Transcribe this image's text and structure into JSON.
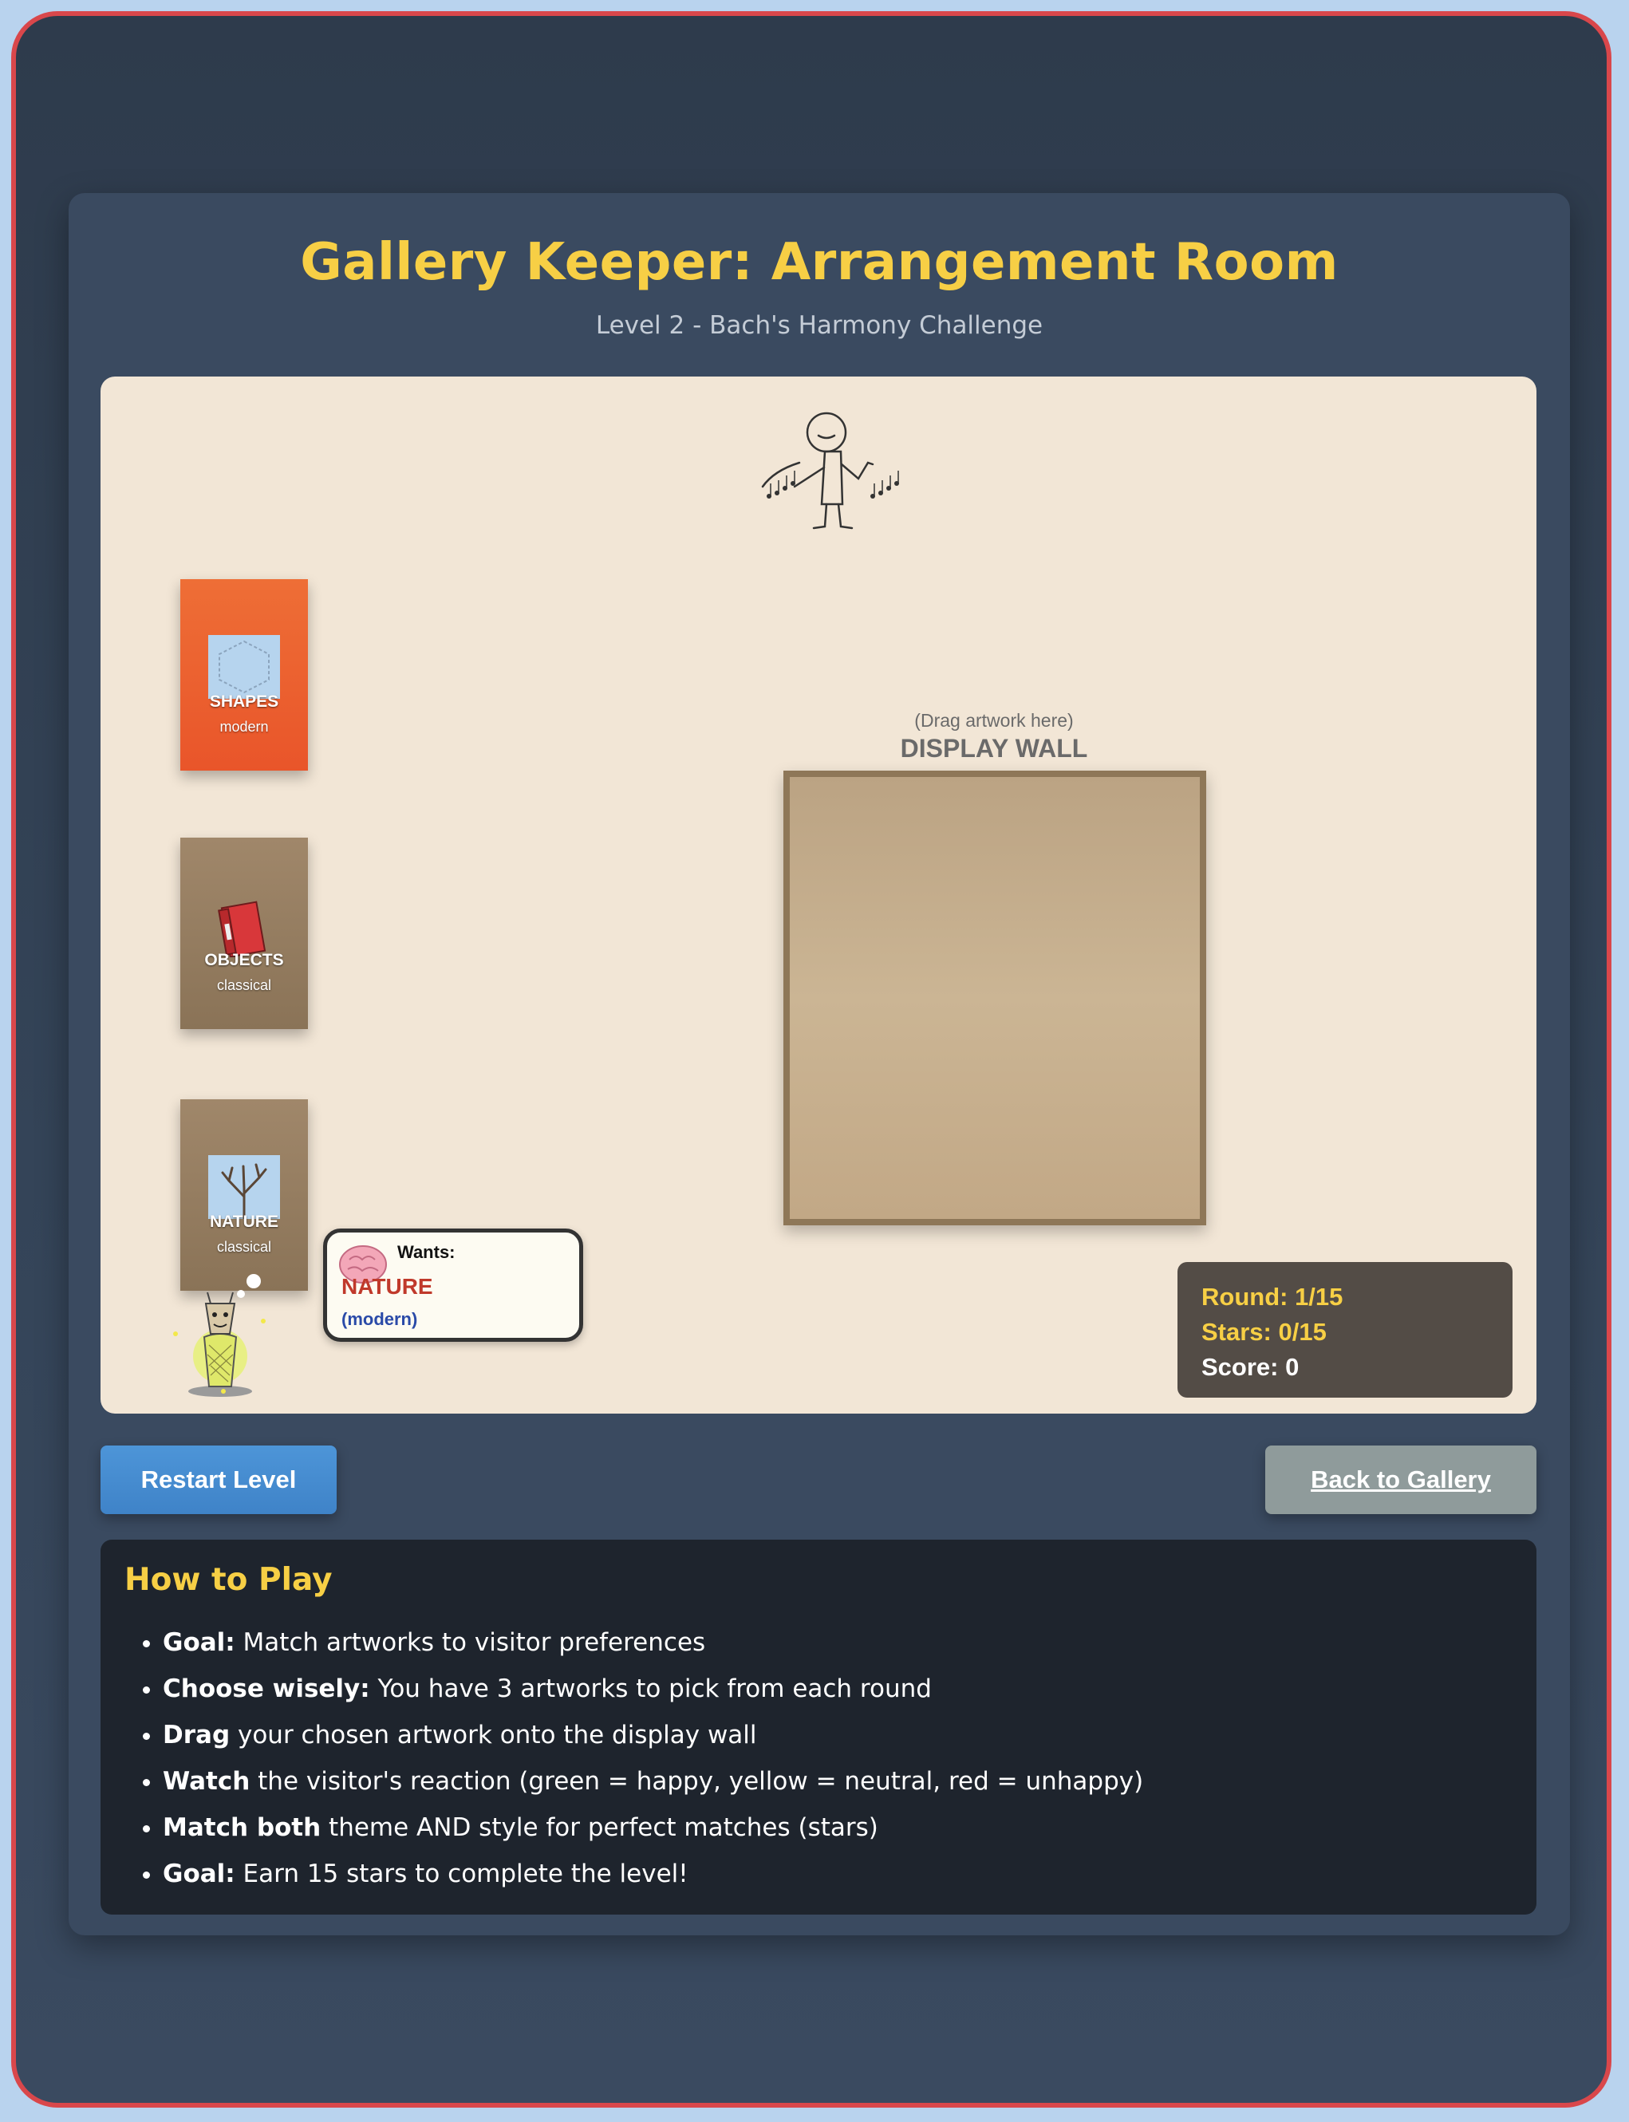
{
  "header": {
    "title": "Gallery Keeper: Arrangement Room",
    "subtitle": "Level 2 - Bach's Harmony Challenge"
  },
  "artworks": [
    {
      "theme": "SHAPES",
      "style": "modern",
      "color": "#e9552a",
      "icon": "hexagon-shape-icon"
    },
    {
      "theme": "OBJECTS",
      "style": "classical",
      "color": "#8a7357",
      "icon": "red-binder-icon"
    },
    {
      "theme": "NATURE",
      "style": "classical",
      "color": "#8a7357",
      "icon": "bare-tree-icon"
    }
  ],
  "display_wall": {
    "hint": "(Drag artwork here)",
    "label": "DISPLAY WALL"
  },
  "visitor": {
    "wants_label": "Wants:",
    "theme": "NATURE",
    "style": "(modern)"
  },
  "stats": {
    "round": "Round: 1/15",
    "stars": "Stars: 0/15",
    "score": "Score: 0"
  },
  "buttons": {
    "restart": "Restart Level",
    "back": "Back to Gallery"
  },
  "how_to_play": {
    "title": "How to Play",
    "items": [
      {
        "bold": "Goal:",
        "text": " Match artworks to visitor preferences"
      },
      {
        "bold": "Choose wisely:",
        "text": " You have 3 artworks to pick from each round"
      },
      {
        "bold": "Drag",
        "text": " your chosen artwork onto the display wall"
      },
      {
        "bold": "Watch",
        "text": " the visitor's reaction (green = happy, yellow = neutral, red = unhappy)"
      },
      {
        "bold": "Match both",
        "text": " theme AND style for perfect matches (stars)"
      },
      {
        "bold": "Goal:",
        "text": " Earn 15 stars to complete the level!"
      }
    ]
  },
  "colors": {
    "accent_yellow": "#f7cf45",
    "frame_red": "#d9474b",
    "restart_blue": "#4a90d9",
    "back_gray": "#8f9b9b"
  }
}
